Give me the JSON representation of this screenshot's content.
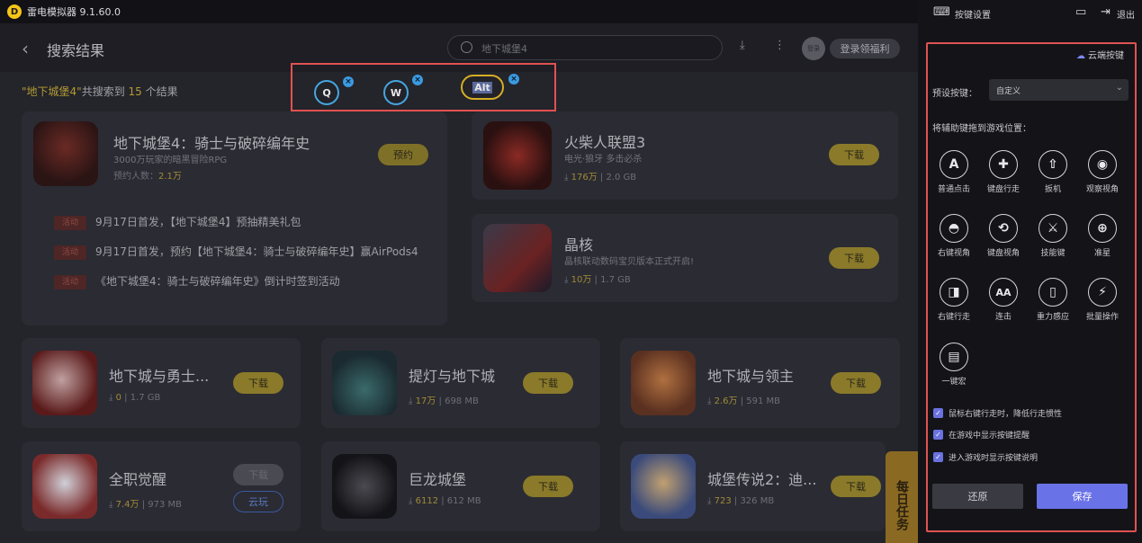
{
  "titlebar": {
    "logo": "D",
    "title": "雷电模拟器 9.1.60.0"
  },
  "header": {
    "title": "搜索结果",
    "search_text": "地下城堡4",
    "avatar_text": "登录",
    "login_label": "登录领福利"
  },
  "results": {
    "query": "\"地下城堡4\"",
    "prefix": "共搜索到",
    "count": "15",
    "suffix": "个结果"
  },
  "featured": {
    "name": "地下城堡4：骑士与破碎编年史",
    "desc": "3000万玩家的暗黑冒险RPG",
    "stat_label": "预约人数：",
    "stat_value": "2.1万",
    "button": "预约",
    "news": [
      {
        "tag": "活动",
        "text": "9月17日首发，【地下城堡4】预抽精美礼包"
      },
      {
        "tag": "活动",
        "text": "9月17日首发，预约【地下城堡4：骑士与破碎编年史】赢AirPods4"
      },
      {
        "tag": "活动",
        "text": "《地下城堡4：骑士与破碎编年史》倒计时签到活动"
      }
    ]
  },
  "side_games": [
    {
      "name": "火柴人联盟3",
      "desc": "电光·狼牙 多击必杀",
      "count": "176万",
      "size": "2.0 GB",
      "button": "下载"
    },
    {
      "name": "晶核",
      "desc": "晶核联动数码宝贝版本正式开启!",
      "count": "10万",
      "size": "1.7 GB",
      "button": "下载"
    }
  ],
  "grid_games": [
    {
      "name": "地下城与勇士...",
      "count": "0",
      "size": "1.7 GB",
      "button": "下载"
    },
    {
      "name": "提灯与地下城",
      "count": "17万",
      "size": "698 MB",
      "button": "下载"
    },
    {
      "name": "地下城与领主",
      "count": "2.6万",
      "size": "591 MB",
      "button": "下载"
    },
    {
      "name": "全职觉醒",
      "count": "7.4万",
      "size": "973 MB",
      "button": "下载",
      "button2": "云玩"
    },
    {
      "name": "巨龙城堡",
      "count": "6112",
      "size": "612 MB",
      "button": "下载"
    },
    {
      "name": "城堡传说2：迪...",
      "count": "723",
      "size": "326 MB",
      "button": "下载"
    }
  ],
  "daily_tab": "每日任务",
  "key_overlay": {
    "keys": [
      "Q",
      "W",
      "Alt"
    ],
    "remove_icon": "×"
  },
  "panel": {
    "title": "按键设置",
    "exit_label": "退出",
    "cloud_label": "云端按键",
    "preset_label": "预设按键：",
    "preset_value": "自定义",
    "drag_hint": "将辅助键拖到游戏位置：",
    "tools": [
      {
        "label": "普通点击",
        "glyph": "A"
      },
      {
        "label": "键盘行走",
        "glyph": "✚"
      },
      {
        "label": "扳机",
        "glyph": "⇧"
      },
      {
        "label": "观察视角",
        "glyph": "◉"
      },
      {
        "label": "右键视角",
        "glyph": "◓"
      },
      {
        "label": "键盘视角",
        "glyph": "⟲"
      },
      {
        "label": "技能键",
        "glyph": "⚔"
      },
      {
        "label": "准星",
        "glyph": "⊕"
      },
      {
        "label": "右键行走",
        "glyph": "◨"
      },
      {
        "label": "连击",
        "glyph": "AA"
      },
      {
        "label": "重力感应",
        "glyph": "▯"
      },
      {
        "label": "批量操作",
        "glyph": "⚡"
      },
      {
        "label": "一键宏",
        "glyph": "▤"
      }
    ],
    "checks": [
      {
        "label": "鼠标右键行走时，降低行走惯性",
        "checked": true
      },
      {
        "label": "在游戏中显示按键提醒",
        "checked": true
      },
      {
        "label": "进入游戏时显示按键说明",
        "checked": true
      }
    ],
    "reset_label": "还原",
    "save_label": "保存"
  }
}
